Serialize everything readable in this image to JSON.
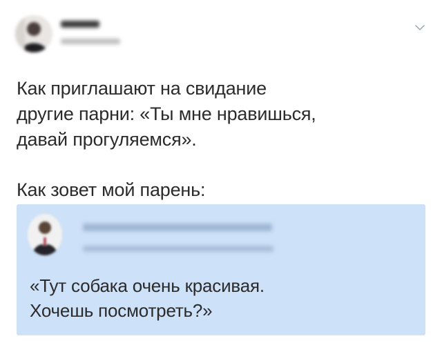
{
  "tweet": {
    "author": {
      "name": "",
      "meta": "",
      "avatar_icon": "user-avatar-blurred"
    },
    "menu_icon": "chevron-down-icon",
    "text_paragraph_1": "Как приглашают на свидание\nдругие парни: «Ты мне нравишься,\nдавай прогуляемся».",
    "text_paragraph_2": "Как зовет мой парень:"
  },
  "quoted_post": {
    "background_color": "#cde1f8",
    "author": {
      "name": "",
      "meta": "",
      "avatar_icon": "user-avatar-blurred"
    },
    "text": "«Тут собака очень красивая.\nХочешь посмотреть?»"
  }
}
